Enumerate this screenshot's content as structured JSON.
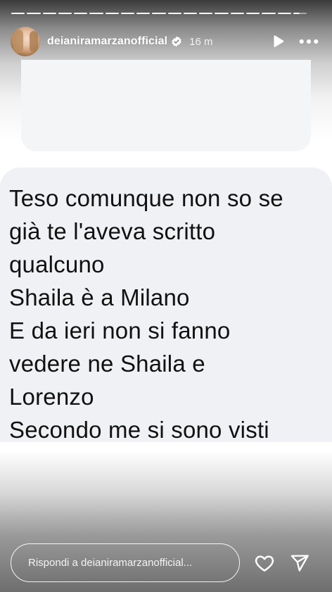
{
  "story": {
    "progress_segments": [
      1,
      1,
      1,
      1,
      1,
      1,
      1,
      1,
      1,
      1,
      1,
      1,
      1,
      1,
      1,
      1,
      1,
      1,
      0.45
    ],
    "header": {
      "username": "deianiramarzanofficial",
      "verified": true,
      "time_ago": "16 m",
      "play_icon": "play-icon",
      "more_icon": "more-horizontal-icon"
    },
    "message": {
      "lines": [
        "Teso comunque non so se",
        "già te l'aveva scritto",
        "qualcuno",
        "Shaila è a Milano",
        "E da ieri non si fanno",
        "vedere ne Shaila e",
        "Lorenzo",
        "Secondo me si sono visti"
      ]
    },
    "footer": {
      "reply_placeholder": "Rispondi a deianiramarzanofficial...",
      "like_icon": "heart-icon",
      "send_icon": "send-icon"
    }
  },
  "colors": {
    "text": "#111111",
    "bubble": "#f0f1f4",
    "ui_white": "#ffffff"
  }
}
